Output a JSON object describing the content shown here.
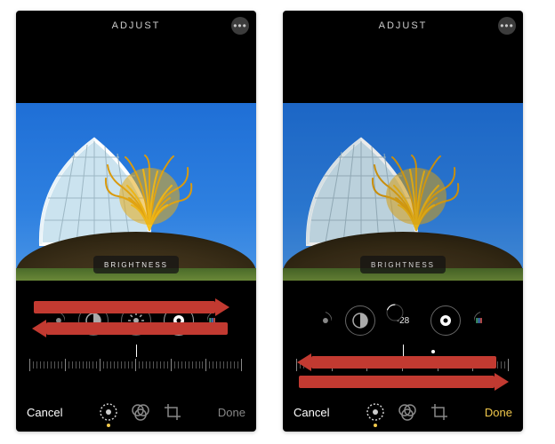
{
  "left": {
    "header_title": "ADJUST",
    "badge": "BRIGHTNESS",
    "cancel": "Cancel",
    "done": "Done"
  },
  "right": {
    "header_title": "ADJUST",
    "badge": "BRIGHTNESS",
    "value": "-28",
    "cancel": "Cancel",
    "done": "Done"
  }
}
